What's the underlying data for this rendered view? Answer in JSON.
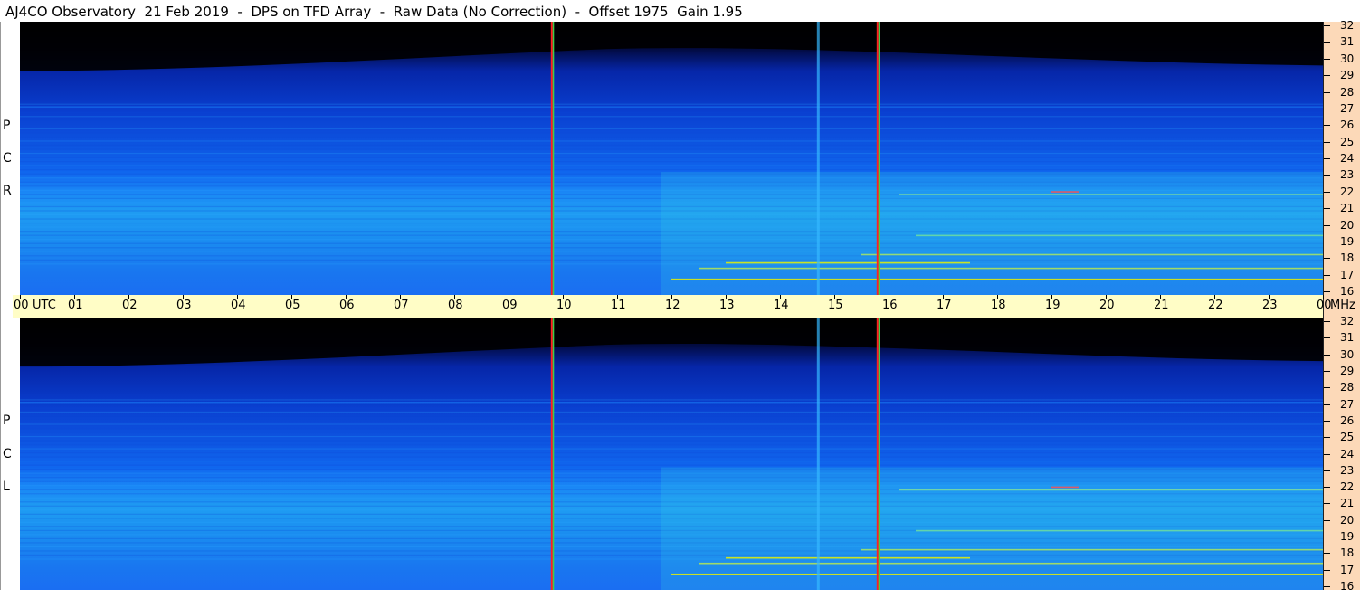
{
  "title": "AJ4CO Observatory  21 Feb 2019  -  DPS on TFD Array  -  Raw Data (No Correction)  -  Offset 1975  Gain 1.95",
  "colors": {
    "background_night": "#000000",
    "band_deep": "#0a2fc0",
    "band_mid": "#1577ff",
    "band_low": "#25b4f0",
    "rfi_yellow": "#e8f000",
    "marker_red": "#ff2020",
    "marker_green": "#3ecf4a",
    "time_bar": "#fffdc6",
    "freq_strip": "#fcd9b8"
  },
  "panels": [
    {
      "label_letters": [
        "R",
        "C",
        "P"
      ]
    },
    {
      "label_letters": [
        "L",
        "C",
        "P"
      ]
    }
  ],
  "chart_data": {
    "type": "heatmap",
    "x_axis": {
      "unit_label": "UTC",
      "labels": [
        "00",
        "01",
        "02",
        "03",
        "04",
        "05",
        "06",
        "07",
        "08",
        "09",
        "10",
        "11",
        "12",
        "13",
        "14",
        "15",
        "16",
        "17",
        "18",
        "19",
        "20",
        "21",
        "22",
        "23",
        "00"
      ],
      "range": [
        0,
        24
      ]
    },
    "y_axis": {
      "unit_label": "MHz",
      "labels": [
        "16",
        "17",
        "18",
        "19",
        "20",
        "21",
        "22",
        "23",
        "24",
        "25",
        "26",
        "27",
        "28",
        "29",
        "30",
        "31",
        "32"
      ],
      "range": [
        16,
        32
      ]
    },
    "markers_utc": [
      9.78,
      15.78
    ],
    "series": [
      {
        "name": "RCP"
      },
      {
        "name": "LCP"
      }
    ]
  }
}
